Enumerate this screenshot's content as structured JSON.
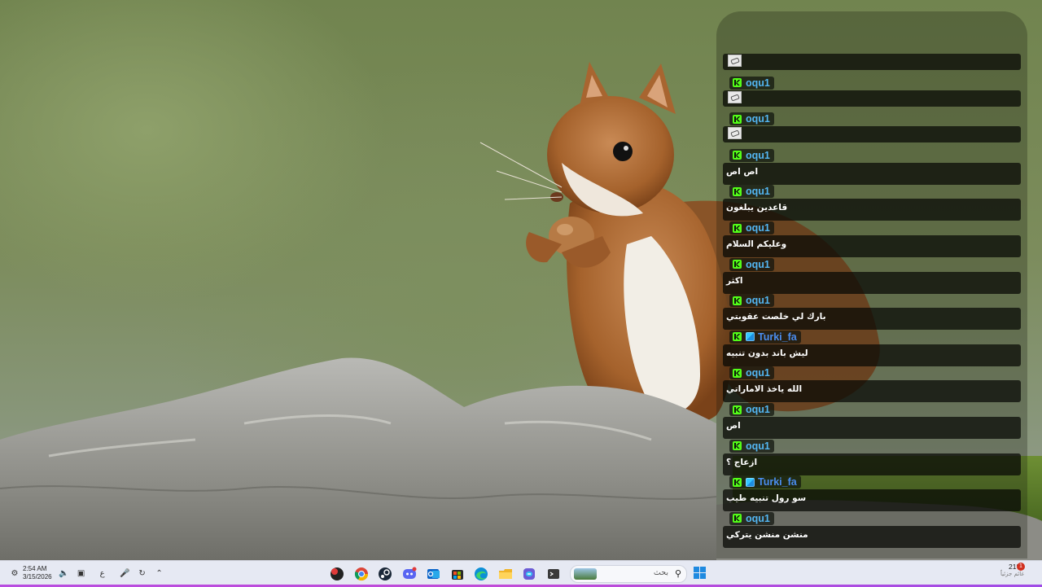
{
  "chat": {
    "messages": [
      {
        "username": "",
        "badges": [],
        "text": "",
        "emote": true
      },
      {
        "username": "oqu1",
        "badges": [
          "kick-icon"
        ],
        "text": "",
        "emote": true
      },
      {
        "username": "oqu1",
        "badges": [
          "kick-icon"
        ],
        "text": "",
        "emote": true
      },
      {
        "username": "oqu1",
        "badges": [
          "kick-icon"
        ],
        "text": "اص اص",
        "emote": false
      },
      {
        "username": "oqu1",
        "badges": [
          "kick-icon"
        ],
        "text": "قاعدين يبلغون",
        "emote": false
      },
      {
        "username": "oqu1",
        "badges": [
          "kick-icon"
        ],
        "text": "وعليكم السلام",
        "emote": false
      },
      {
        "username": "oqu1",
        "badges": [
          "kick-icon"
        ],
        "text": "اكثر",
        "emote": false
      },
      {
        "username": "oqu1",
        "badges": [
          "kick-icon"
        ],
        "text": "بارك لي خلصت عقوبتي",
        "emote": false
      },
      {
        "username": "Turki_fa",
        "badges": [
          "kick-icon",
          "subscriber-icon"
        ],
        "text": "ليش باند بدون تنبيه",
        "emote": false
      },
      {
        "username": "oqu1",
        "badges": [
          "kick-icon"
        ],
        "text": "الله ياخذ الاماراتي",
        "emote": false
      },
      {
        "username": "oqu1",
        "badges": [
          "kick-icon"
        ],
        "text": "اص",
        "emote": false
      },
      {
        "username": "oqu1",
        "badges": [
          "kick-icon"
        ],
        "text": "ازعاج ؟",
        "emote": false
      },
      {
        "username": "Turki_fa",
        "badges": [
          "kick-icon",
          "subscriber-icon"
        ],
        "text": "سو رول تنبيه طيب",
        "emote": false
      },
      {
        "username": "oqu1",
        "badges": [
          "kick-icon"
        ],
        "text": "منشن منشن يتركي",
        "emote": false
      }
    ],
    "colors": {
      "oqu1": "#53b6f2",
      "Turki_fa": "#4a8df0"
    }
  },
  "taskbar": {
    "time": "2:54 AM",
    "date": "3/15/2026",
    "lang": "ع",
    "search_placeholder": "بحث",
    "weather_temp": "21°C",
    "weather_desc": "غائم جزئياً",
    "notification_count": "1",
    "apps": [
      "chrome-icon",
      "steam-icon",
      "discord-icon",
      "outlook-icon",
      "store-icon",
      "edge-icon",
      "file-explorer-icon",
      "copilot-icon",
      "terminal-icon"
    ],
    "accent_color": "#b84de0"
  }
}
